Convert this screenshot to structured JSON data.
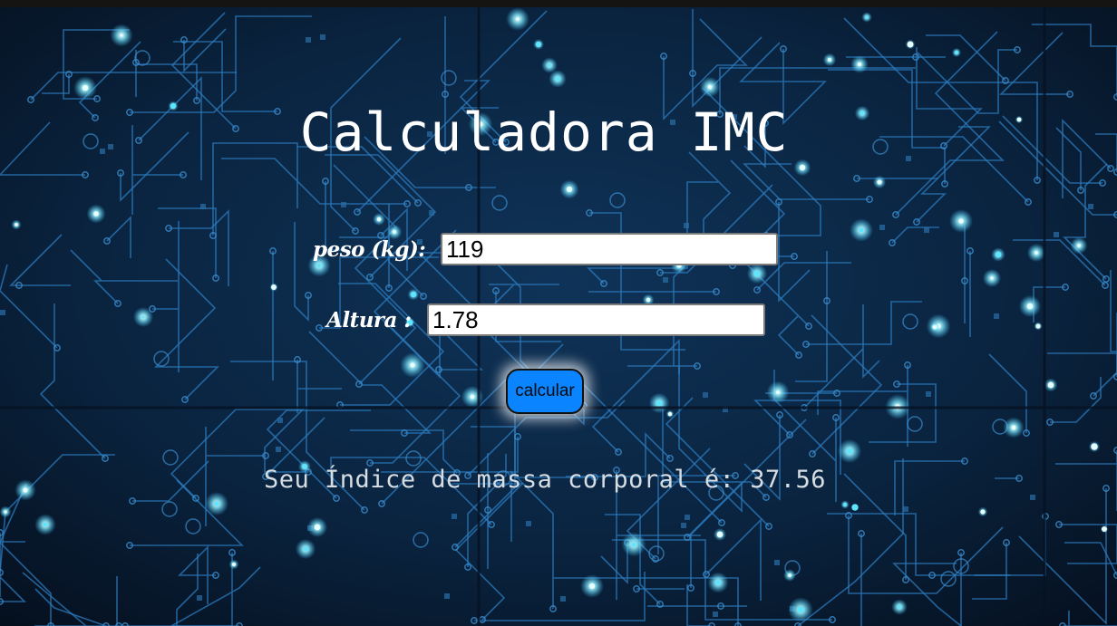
{
  "page": {
    "title": "Calculadora IMC"
  },
  "form": {
    "peso_label": "peso (kg):",
    "peso_value": "119",
    "altura_label": "Altura :",
    "altura_value": "1.78",
    "button_label": "calcular"
  },
  "result": {
    "text": "Seu Índice de massa corporal é: 37.56"
  },
  "colors": {
    "background": "#08182a",
    "circuit": "#2a6fa8",
    "glow": "#4fe0ff",
    "button": "#0a84ff",
    "text": "#ffffff"
  }
}
